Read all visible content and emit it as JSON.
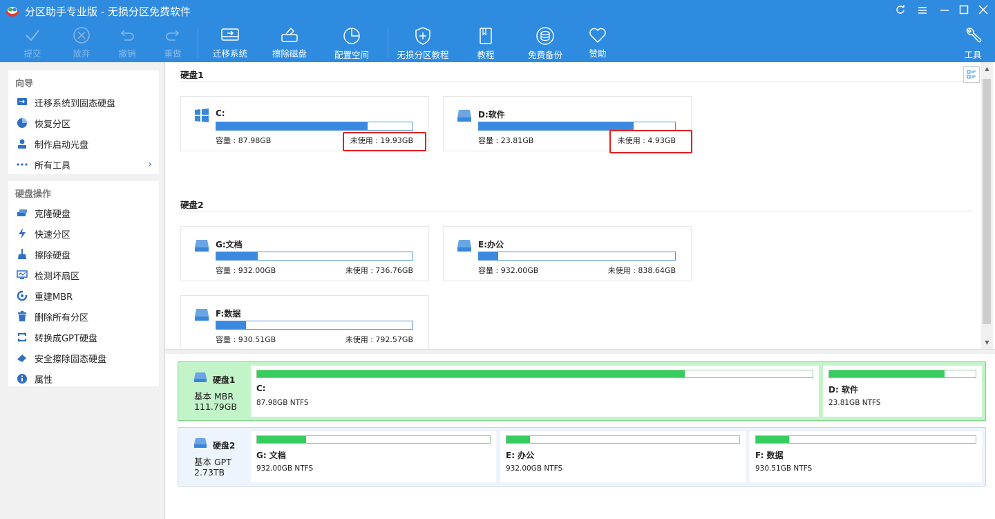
{
  "window": {
    "title": "分区助手专业版 - 无损分区免费软件",
    "controls": [
      "refresh-icon",
      "menu-icon",
      "minimize-icon",
      "maximize-icon",
      "close-icon"
    ]
  },
  "toolbar": {
    "submit": "提交",
    "discard": "放弃",
    "undo": "撤销",
    "redo": "重做",
    "migrate": "迁移系统",
    "wipe": "擦除磁盘",
    "allocate": "配置空间",
    "tutorial_lossless": "无损分区教程",
    "tutorial": "教程",
    "backup": "免费备份",
    "sponsor": "赞助",
    "tools": "工具"
  },
  "wizard": {
    "header": "向导",
    "items": [
      "迁移系统到固态硬盘",
      "恢复分区",
      "制作启动光盘",
      "所有工具"
    ]
  },
  "disk_ops": {
    "header": "硬盘操作",
    "items": [
      "克隆硬盘",
      "快速分区",
      "擦除硬盘",
      "检测坏扇区",
      "重建MBR",
      "删除所有分区",
      "转换成GPT硬盘",
      "安全擦除固态硬盘",
      "属性"
    ]
  },
  "cards": {
    "disk1_label": "硬盘1",
    "disk2_label": "硬盘2",
    "c": {
      "name": "C:",
      "cap": "容量 : 87.98GB",
      "free": "未使用 : 19.93GB",
      "used_fraction": 0.77
    },
    "d": {
      "name": "D:软件",
      "cap": "容量 : 23.81GB",
      "free": "未使用 : 4.93GB",
      "used_fraction": 0.79
    },
    "g": {
      "name": "G:文档",
      "cap": "容量 : 932.00GB",
      "free": "未使用 : 736.76GB",
      "used_fraction": 0.21
    },
    "e": {
      "name": "E:办公",
      "cap": "容量 : 932.00GB",
      "free": "未使用 : 838.64GB",
      "used_fraction": 0.1
    },
    "f": {
      "name": "F:数据",
      "cap": "容量 : 930.51GB",
      "free": "未使用 : 792.57GB",
      "used_fraction": 0.15
    }
  },
  "diskmap": {
    "disk1": {
      "name": "硬盘1",
      "type": "基本 MBR",
      "size": "111.79GB"
    },
    "disk2": {
      "name": "硬盘2",
      "type": "基本 GPT",
      "size": "2.73TB"
    },
    "parts": {
      "c": {
        "name": "C:",
        "info": "87.98GB NTFS",
        "used_fraction": 0.77
      },
      "d": {
        "name": "D: 软件",
        "info": "23.81GB NTFS",
        "used_fraction": 0.79
      },
      "g": {
        "name": "G: 文档",
        "info": "932.00GB NTFS",
        "used_fraction": 0.21
      },
      "e": {
        "name": "E: 办公",
        "info": "932.00GB NTFS",
        "used_fraction": 0.1
      },
      "f": {
        "name": "F: 数据",
        "info": "930.51GB NTFS",
        "used_fraction": 0.15
      }
    }
  },
  "colors": {
    "accent": "#2f8be0",
    "partition_fill": "#36cd5e",
    "highlight_box": "#e21d1d",
    "selected_disk": "#c3f3c8"
  }
}
